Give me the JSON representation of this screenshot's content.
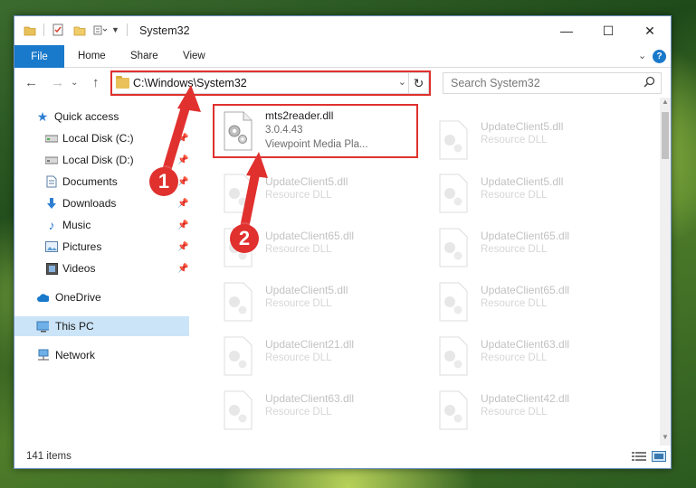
{
  "window": {
    "title": "System32",
    "minimize": "—",
    "maximize": "☐",
    "close": "✕"
  },
  "ribbon": {
    "tabs": [
      "File",
      "Home",
      "Share",
      "View"
    ],
    "expand": "⌄",
    "help": "?"
  },
  "nav": {
    "back": "←",
    "forward": "→",
    "recent": "⌄",
    "up": "↑",
    "address": "C:\\Windows\\System32",
    "address_dropdown": "⌄",
    "refresh": "↻",
    "search_placeholder": "Search System32",
    "search_icon": "⌕"
  },
  "sidebar": {
    "items": [
      {
        "label": "Quick access",
        "icon": "star-icon"
      },
      {
        "label": "Local Disk (C:)",
        "icon": "drive-icon",
        "pinned": true
      },
      {
        "label": "Local Disk (D:)",
        "icon": "drive-icon",
        "pinned": true
      },
      {
        "label": "Documents",
        "icon": "documents-icon",
        "pinned": true
      },
      {
        "label": "Downloads",
        "icon": "downloads-icon",
        "pinned": true
      },
      {
        "label": "Music",
        "icon": "music-icon",
        "pinned": true
      },
      {
        "label": "Pictures",
        "icon": "pictures-icon",
        "pinned": true
      },
      {
        "label": "Videos",
        "icon": "videos-icon",
        "pinned": true
      },
      {
        "label": "OneDrive",
        "icon": "cloud-icon"
      },
      {
        "label": "This PC",
        "icon": "computer-icon",
        "selected": true
      },
      {
        "label": "Network",
        "icon": "network-icon"
      }
    ]
  },
  "files": {
    "highlighted": {
      "name": "mts2reader.dll",
      "version": "3.0.4.43",
      "description": "Viewpoint Media Pla..."
    },
    "background": [
      {
        "name": "UpdateClient5.dll",
        "type": "Resource DLL"
      },
      {
        "name": "UpdateClient5.dll",
        "type": "Resource DLL"
      },
      {
        "name": "UpdateClient5.dll",
        "type": "Resource DLL"
      },
      {
        "name": "UpdateClient65.dll",
        "type": "Resource DLL"
      },
      {
        "name": "UpdateClient65.dll",
        "type": "Resource DLL"
      },
      {
        "name": "UpdateClient5.dll",
        "type": "Resource DLL"
      },
      {
        "name": "UpdateClient65.dll",
        "type": "Resource DLL"
      },
      {
        "name": "UpdateClient21.dll",
        "type": "Resource DLL"
      },
      {
        "name": "UpdateClient63.dll",
        "type": "Resource DLL"
      },
      {
        "name": "UpdateClient63.dll",
        "type": "Resource DLL"
      },
      {
        "name": "UpdateClient42.dll",
        "type": "Resource DLL"
      }
    ]
  },
  "status": {
    "item_count": "141 items"
  },
  "callouts": [
    "1",
    "2"
  ],
  "colors": {
    "accent": "#1979ca",
    "highlight": "#e0312f",
    "selection": "#cce4f7"
  }
}
